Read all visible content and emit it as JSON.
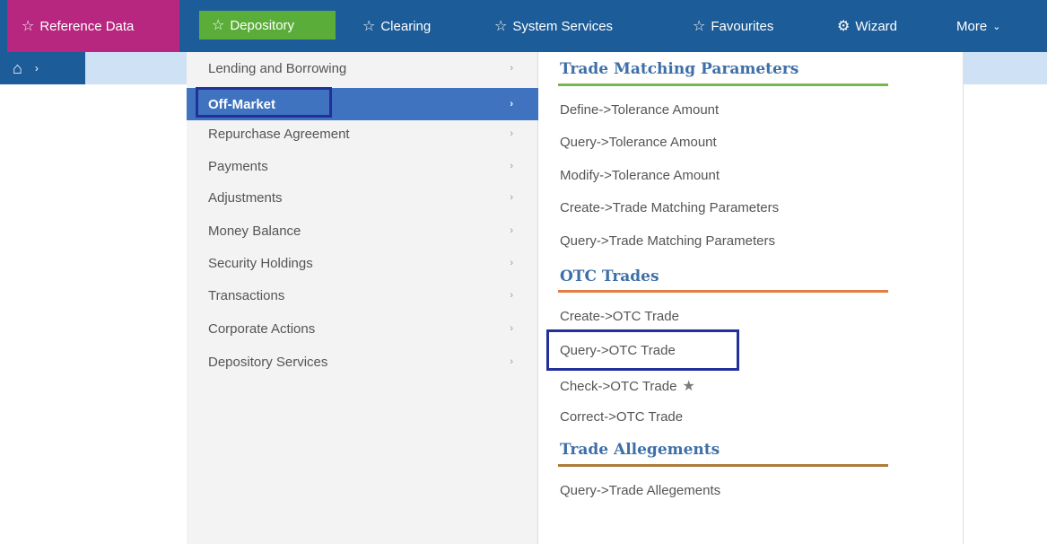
{
  "topnav": {
    "items": [
      {
        "label": "Reference Data",
        "icon": "star-outline-icon"
      },
      {
        "label": "Depository",
        "icon": "star-outline-icon"
      },
      {
        "label": "Clearing",
        "icon": "star-outline-icon"
      },
      {
        "label": "System Services",
        "icon": "star-outline-icon"
      },
      {
        "label": "Favourites",
        "icon": "star-outline-icon"
      },
      {
        "label": "Wizard",
        "icon": "gear-icon"
      },
      {
        "label": "More",
        "icon": "chevron-down-icon"
      }
    ],
    "colors": {
      "bar": "#1c5c98",
      "reference": "#b7267f",
      "depository": "#5bad3a"
    }
  },
  "breadcrumb": {
    "home_icon": "home-icon",
    "separator_icon": "chevron-right-icon"
  },
  "submenu": {
    "items": [
      {
        "label": "Lending and Borrowing"
      },
      {
        "label": "Off-Market",
        "active": true
      },
      {
        "label": "Repurchase Agreement"
      },
      {
        "label": "Payments"
      },
      {
        "label": "Adjustments"
      },
      {
        "label": "Money Balance"
      },
      {
        "label": "Security Holdings"
      },
      {
        "label": "Transactions"
      },
      {
        "label": "Corporate Actions"
      },
      {
        "label": "Depository Services"
      }
    ],
    "active_color": "#3f72bf"
  },
  "panel": {
    "sections": [
      {
        "title": "Trade Matching Parameters",
        "links": [
          "Define->Tolerance Amount",
          "Query->Tolerance Amount",
          "Modify->Tolerance Amount",
          "Create->Trade Matching Parameters",
          "Query->Trade Matching Parameters"
        ]
      },
      {
        "title": "OTC Trades",
        "links": [
          "Create->OTC Trade",
          "Query->OTC Trade",
          "Check->OTC Trade",
          "Correct->OTC Trade"
        ]
      },
      {
        "title": "Trade Allegements",
        "links": [
          "Query->Trade Allegements"
        ]
      }
    ]
  }
}
